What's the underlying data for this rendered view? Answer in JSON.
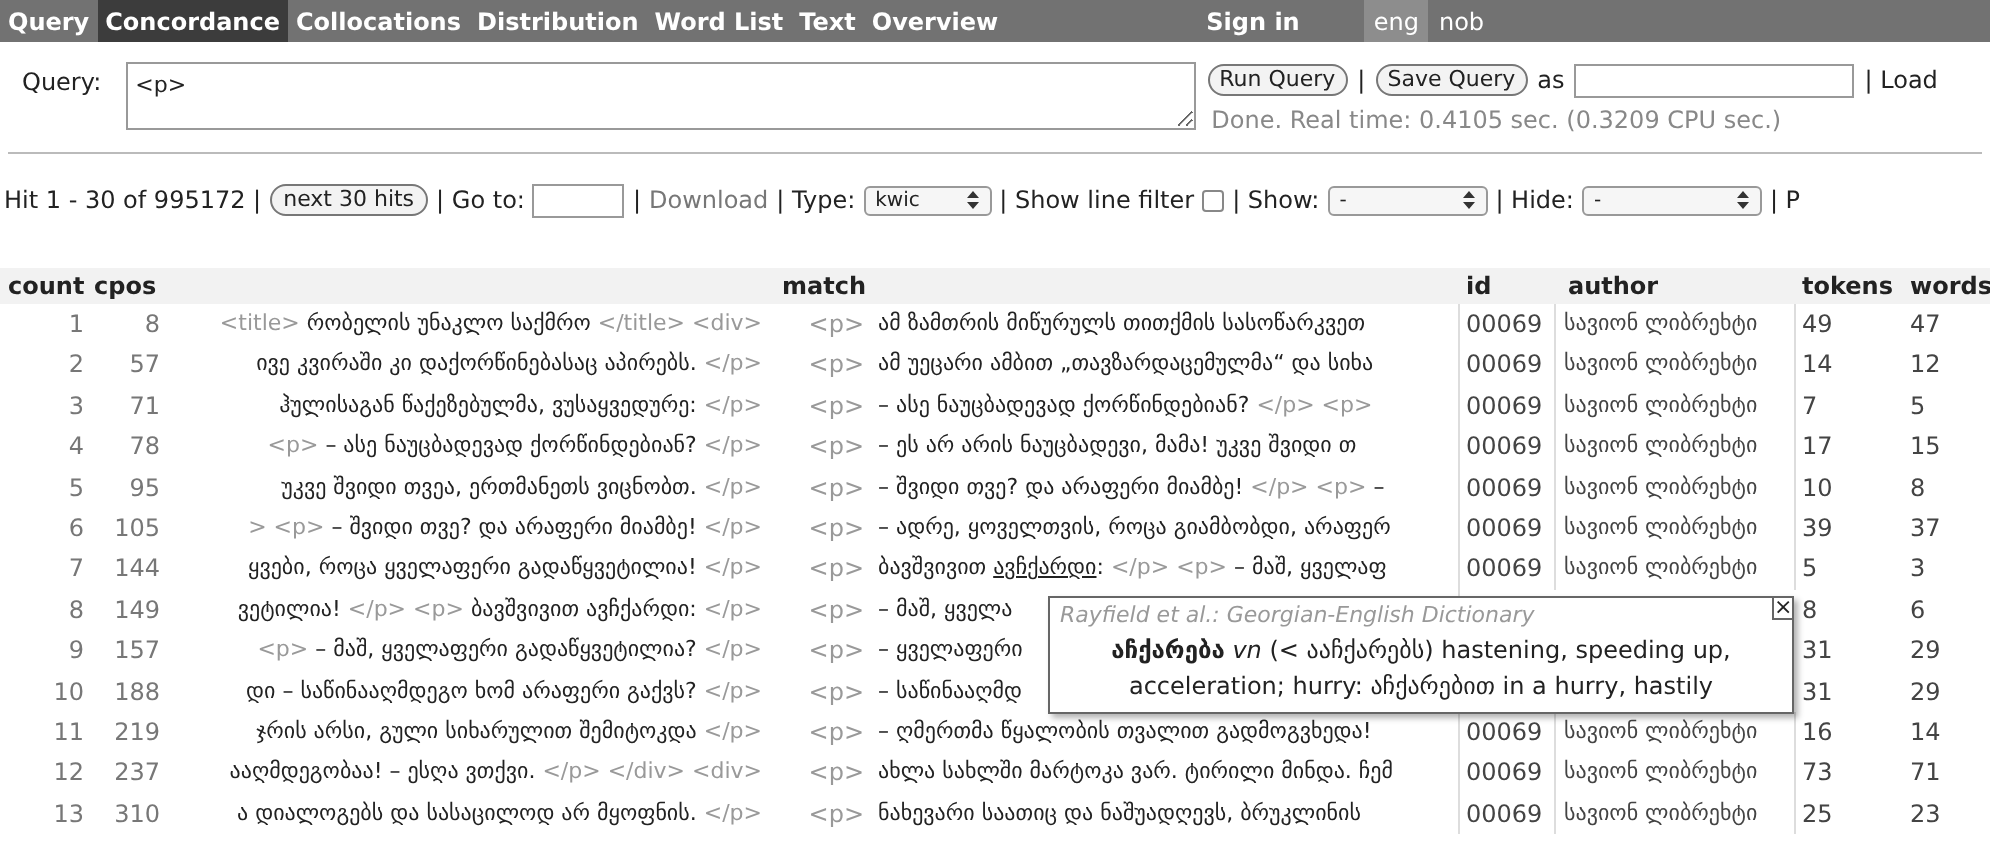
{
  "nav": {
    "tabs": [
      {
        "label": "Query",
        "selected": false
      },
      {
        "label": "Concordance",
        "selected": true
      },
      {
        "label": "Collocations",
        "selected": false
      },
      {
        "label": "Distribution",
        "selected": false
      },
      {
        "label": "Word List",
        "selected": false
      },
      {
        "label": "Text",
        "selected": false
      },
      {
        "label": "Overview",
        "selected": false
      }
    ],
    "sign_in": "Sign in",
    "languages": [
      {
        "label": "eng",
        "selected": true
      },
      {
        "label": "nob",
        "selected": false
      }
    ]
  },
  "query": {
    "label": "Query:",
    "value": "<p>",
    "run_button": "Run Query",
    "separator": "|",
    "save_button": "Save Query",
    "as_label": "as",
    "load_label": "| Load",
    "status": "Done. Real time: 0.4105 sec. (0.3209 CPU sec.)"
  },
  "hits_bar": {
    "hit_label": "Hit 1 - 30 of 995172 |",
    "next_button": "next 30 hits",
    "goto_label": "| Go to:",
    "sep1": "|",
    "download": "Download",
    "type_label": "| Type:",
    "type_value": "kwic",
    "filter_label": "| Show line filter",
    "filter_checked": false,
    "show_label": "| Show:",
    "show_value": "-",
    "hide_label": "| Hide:",
    "hide_value": "-",
    "cut_label": "| P"
  },
  "table": {
    "columns": [
      "count",
      "cpos",
      "match",
      "id",
      "author",
      "tokens",
      "words"
    ],
    "rows": [
      {
        "count": "1",
        "cpos": "8",
        "left": [
          {
            "kind": "tag",
            "text": "<title>"
          },
          {
            "kind": "word",
            "text": "რობელის უნაკლო საქმრო"
          },
          {
            "kind": "tag",
            "text": "</title> <div>"
          }
        ],
        "match": "<p>",
        "right": [
          {
            "kind": "word",
            "text": "ამ ზამთრის მიწურულს თითქმის სასოწარკვეთ"
          }
        ],
        "id": "00069",
        "author": "სავიონ ლიბრეხტი",
        "tokens": "49",
        "words": "47"
      },
      {
        "count": "2",
        "cpos": "57",
        "left": [
          {
            "kind": "word",
            "text": "ივე კვირაში კი დაქორწინებასაც აპირებს."
          },
          {
            "kind": "tag",
            "text": "</p>"
          }
        ],
        "match": "<p>",
        "right": [
          {
            "kind": "word",
            "text": "ამ უეცარი ამბით „თავზარდაცემულმა“ და სიხა"
          }
        ],
        "id": "00069",
        "author": "სავიონ ლიბრეხტი",
        "tokens": "14",
        "words": "12"
      },
      {
        "count": "3",
        "cpos": "71",
        "left": [
          {
            "kind": "word",
            "text": "ჰულისაგან წაქეზებულმა, ვუსაყვედურე:"
          },
          {
            "kind": "tag",
            "text": "</p>"
          }
        ],
        "match": "<p>",
        "right": [
          {
            "kind": "word",
            "text": "– ასე ნაუცბადევად ქორწინდებიან?"
          },
          {
            "kind": "tag",
            "text": "</p> <p>"
          }
        ],
        "id": "00069",
        "author": "სავიონ ლიბრეხტი",
        "tokens": "7",
        "words": "5"
      },
      {
        "count": "4",
        "cpos": "78",
        "left": [
          {
            "kind": "tag",
            "text": "<p>"
          },
          {
            "kind": "word",
            "text": "– ასე ნაუცბადევად ქორწინდებიან?"
          },
          {
            "kind": "tag",
            "text": "</p>"
          }
        ],
        "match": "<p>",
        "right": [
          {
            "kind": "word",
            "text": "– ეს არ არის ნაუცბადევი, მამა! უკვე შვიდი თ"
          }
        ],
        "id": "00069",
        "author": "სავიონ ლიბრეხტი",
        "tokens": "17",
        "words": "15"
      },
      {
        "count": "5",
        "cpos": "95",
        "left": [
          {
            "kind": "word",
            "text": "უკვე შვიდი თვეა, ერთმანეთს ვიცნობთ."
          },
          {
            "kind": "tag",
            "text": "</p>"
          }
        ],
        "match": "<p>",
        "right": [
          {
            "kind": "word",
            "text": "– შვიდი თვე? და არაფერი მიამბე!"
          },
          {
            "kind": "tag",
            "text": "</p> <p>"
          },
          {
            "kind": "word",
            "text": "–"
          }
        ],
        "id": "00069",
        "author": "სავიონ ლიბრეხტი",
        "tokens": "10",
        "words": "8"
      },
      {
        "count": "6",
        "cpos": "105",
        "left": [
          {
            "kind": "tag",
            "text": "> <p>"
          },
          {
            "kind": "word",
            "text": "– შვიდი თვე? და არაფერი მიამბე!"
          },
          {
            "kind": "tag",
            "text": "</p>"
          }
        ],
        "match": "<p>",
        "right": [
          {
            "kind": "word",
            "text": "– ადრე, ყოველთვის, როცა გიამბობდი, არაფერ"
          }
        ],
        "id": "00069",
        "author": "სავიონ ლიბრეხტი",
        "tokens": "39",
        "words": "37"
      },
      {
        "count": "7",
        "cpos": "144",
        "left": [
          {
            "kind": "word",
            "text": "ყვები, როცა ყველაფერი გადაწყვეტილია!"
          },
          {
            "kind": "tag",
            "text": "</p>"
          }
        ],
        "match": "<p>",
        "right": [
          {
            "kind": "word",
            "text": "ბავშვივით"
          },
          {
            "kind": "hover",
            "text": "ავჩქარდი"
          },
          {
            "kind": "word",
            "text": ":"
          },
          {
            "kind": "tag",
            "text": "</p> <p>"
          },
          {
            "kind": "word",
            "text": "– მაშ, ყველაფ"
          }
        ],
        "id": "00069",
        "author": "სავიონ ლიბრეხტი",
        "tokens": "5",
        "words": "3"
      },
      {
        "count": "8",
        "cpos": "149",
        "left": [
          {
            "kind": "word",
            "text": "ვეტილია!"
          },
          {
            "kind": "tag",
            "text": "</p> <p>"
          },
          {
            "kind": "word",
            "text": "ბავშვივით ავჩქარდი:"
          },
          {
            "kind": "tag",
            "text": "</p>"
          }
        ],
        "match": "<p>",
        "right": [
          {
            "kind": "word",
            "text": "– მაშ, ყველა"
          }
        ],
        "tokens": "8",
        "words": "6"
      },
      {
        "count": "9",
        "cpos": "157",
        "left": [
          {
            "kind": "tag",
            "text": "<p>"
          },
          {
            "kind": "word",
            "text": "– მაშ, ყველაფერი გადაწყვეტილია?"
          },
          {
            "kind": "tag",
            "text": "</p>"
          }
        ],
        "match": "<p>",
        "right": [
          {
            "kind": "word",
            "text": "– ყველაფერი"
          }
        ],
        "tokens": "31",
        "words": "29"
      },
      {
        "count": "10",
        "cpos": "188",
        "left": [
          {
            "kind": "word",
            "text": "დი – საწინააღმდეგო ხომ არაფერი გაქვს?"
          },
          {
            "kind": "tag",
            "text": "</p>"
          }
        ],
        "match": "<p>",
        "right": [
          {
            "kind": "word",
            "text": "– საწინააღმდ"
          }
        ],
        "tokens": "31",
        "words": "29"
      },
      {
        "count": "11",
        "cpos": "219",
        "left": [
          {
            "kind": "word",
            "text": "ჯრის არსი, გული სიხარულით შემიტოკდა"
          },
          {
            "kind": "tag",
            "text": "</p>"
          }
        ],
        "match": "<p>",
        "right": [
          {
            "kind": "word",
            "text": "– ღმერთმა წყალობის თვალით გადმოგვხედა!"
          }
        ],
        "id": "00069",
        "author": "სავიონ ლიბრეხტი",
        "tokens": "16",
        "words": "14"
      },
      {
        "count": "12",
        "cpos": "237",
        "left": [
          {
            "kind": "word",
            "text": "ააღმდეგობაა! – ესღა ვთქვი."
          },
          {
            "kind": "tag",
            "text": "</p> </div> <div>"
          }
        ],
        "match": "<p>",
        "right": [
          {
            "kind": "word",
            "text": "ახლა სახლში მარტოკა ვარ. ტირილი მინდა. ჩემ"
          }
        ],
        "id": "00069",
        "author": "სავიონ ლიბრეხტი",
        "tokens": "73",
        "words": "71"
      },
      {
        "count": "13",
        "cpos": "310",
        "left": [
          {
            "kind": "word",
            "text": "ა დიალოგებს და სასაცილოდ არ მყოფნის."
          },
          {
            "kind": "tag",
            "text": "</p>"
          }
        ],
        "match": "<p>",
        "right": [
          {
            "kind": "word",
            "text": "ნახევარი საათიც და ნაშუადღევს, ბრუკლინის"
          }
        ],
        "id": "00069",
        "author": "სავიონ ლიბრეხტი",
        "tokens": "25",
        "words": "23"
      }
    ]
  },
  "popup": {
    "title": "Rayfield et al.: Georgian-English Dictionary",
    "close": "×",
    "text": "**აჩქარება** *vn* (< ააჩქარებს) hastening, speeding up, acceleration; hurry: აჩქარებით in a hurry, hastily"
  }
}
